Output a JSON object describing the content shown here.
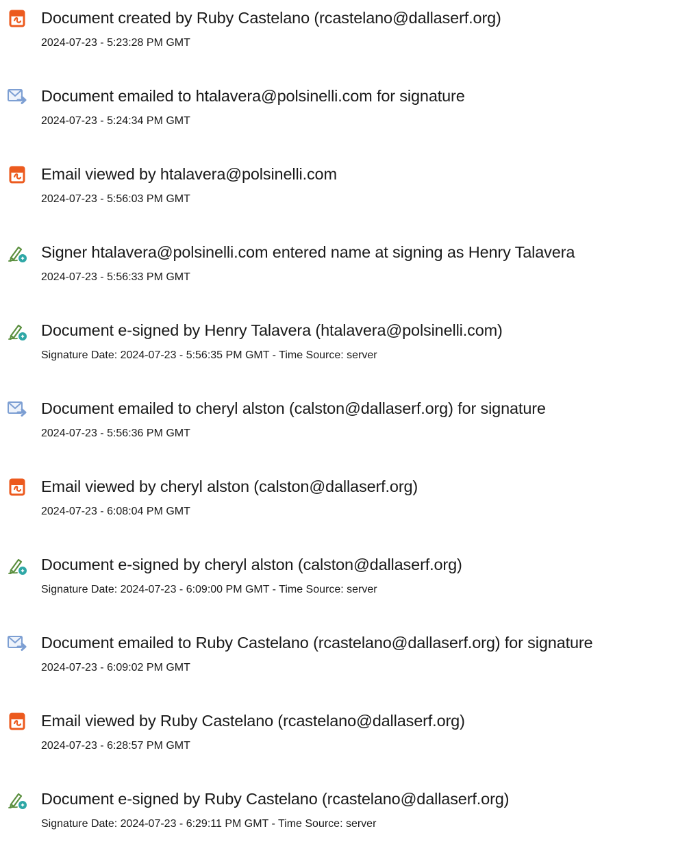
{
  "colors": {
    "pdf_icon": "#ec5a1e",
    "email_icon": "#7d9fd3",
    "sign_icon": "#5b8f3f",
    "sign_badge": "#2ea7a6"
  },
  "events": [
    {
      "icon": "pdf-icon",
      "title": "Document created by Ruby Castelano (rcastelano@dallaserf.org)",
      "time": "2024-07-23 - 5:23:28 PM GMT"
    },
    {
      "icon": "email-icon",
      "title": "Document emailed to htalavera@polsinelli.com for signature",
      "time": "2024-07-23 - 5:24:34 PM GMT"
    },
    {
      "icon": "pdf-icon",
      "title": "Email viewed by htalavera@polsinelli.com",
      "time": "2024-07-23 - 5:56:03 PM GMT"
    },
    {
      "icon": "esign-icon",
      "title": "Signer htalavera@polsinelli.com entered name at signing as Henry Talavera",
      "time": "2024-07-23 - 5:56:33 PM GMT"
    },
    {
      "icon": "esign-icon",
      "title": "Document e-signed by Henry Talavera (htalavera@polsinelli.com)",
      "time": "Signature Date: 2024-07-23 - 5:56:35 PM GMT - Time Source: server"
    },
    {
      "icon": "email-icon",
      "title": "Document emailed to cheryl alston (calston@dallaserf.org) for signature",
      "time": "2024-07-23 - 5:56:36 PM GMT"
    },
    {
      "icon": "pdf-icon",
      "title": "Email viewed by cheryl alston (calston@dallaserf.org)",
      "time": "2024-07-23 - 6:08:04 PM GMT"
    },
    {
      "icon": "esign-icon",
      "title": "Document e-signed by cheryl alston (calston@dallaserf.org)",
      "time": "Signature Date: 2024-07-23 - 6:09:00 PM GMT - Time Source: server"
    },
    {
      "icon": "email-icon",
      "title": "Document emailed to Ruby Castelano (rcastelano@dallaserf.org) for signature",
      "time": "2024-07-23 - 6:09:02 PM GMT"
    },
    {
      "icon": "pdf-icon",
      "title": "Email viewed by Ruby Castelano (rcastelano@dallaserf.org)",
      "time": "2024-07-23 - 6:28:57 PM GMT"
    },
    {
      "icon": "esign-icon",
      "title": "Document e-signed by Ruby Castelano (rcastelano@dallaserf.org)",
      "time": "Signature Date: 2024-07-23 - 6:29:11 PM GMT - Time Source: server"
    }
  ]
}
